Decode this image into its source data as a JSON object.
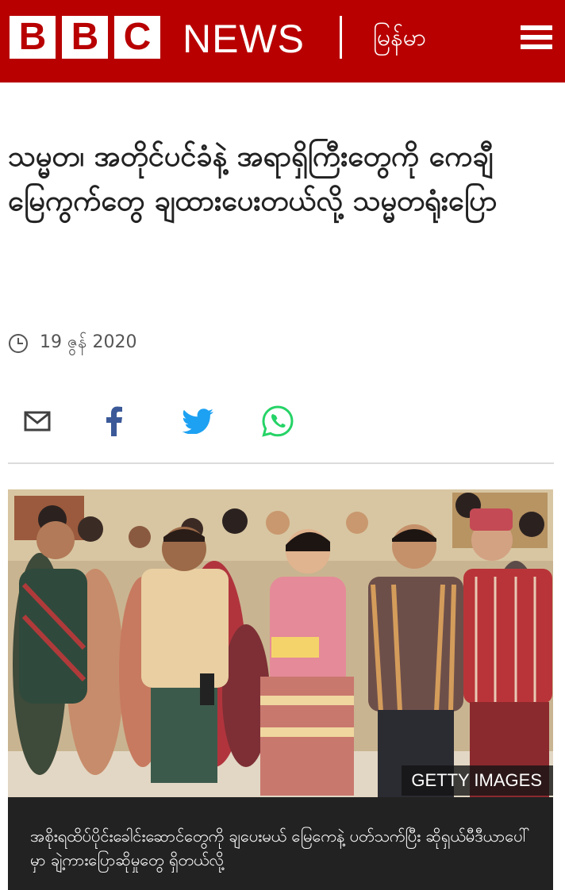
{
  "header": {
    "logo": [
      "B",
      "B",
      "C"
    ],
    "news_label": "NEWS",
    "language": "မြန်မာ",
    "menu_icon": "hamburger-menu-icon",
    "background_color": "#b80000"
  },
  "article": {
    "headline": "သမ္မတ၊ အတိုင်ပင်ခံနဲ့ အရာရှိကြီးတွေကို ကေချီ မြေကွက်တွေ ချထားပေးတယ်လို့ သမ္မတရုံးပြော",
    "date": "19 ဇွန် 2020",
    "date_icon": "clock-icon"
  },
  "share": {
    "items": [
      {
        "icon": "email-icon",
        "color": "#404040"
      },
      {
        "icon": "facebook-icon",
        "color": "#3b5998"
      },
      {
        "icon": "twitter-icon",
        "color": "#1da1f2"
      },
      {
        "icon": "whatsapp-icon",
        "color": "#25d366"
      }
    ]
  },
  "image": {
    "credit": "GETTY IMAGES",
    "caption": "အစိုးရထိပ်ပိုင်းခေါင်းဆောင်တွေကို ချပေးမယ် မြေကေနဲ့ ပတ်သက်ပြီး ဆိုရှယ်မီဒီယာပေါ် မှာ ချဲ့ကားပြောဆိုမှုတွေ ရှိတယ်လို့"
  }
}
